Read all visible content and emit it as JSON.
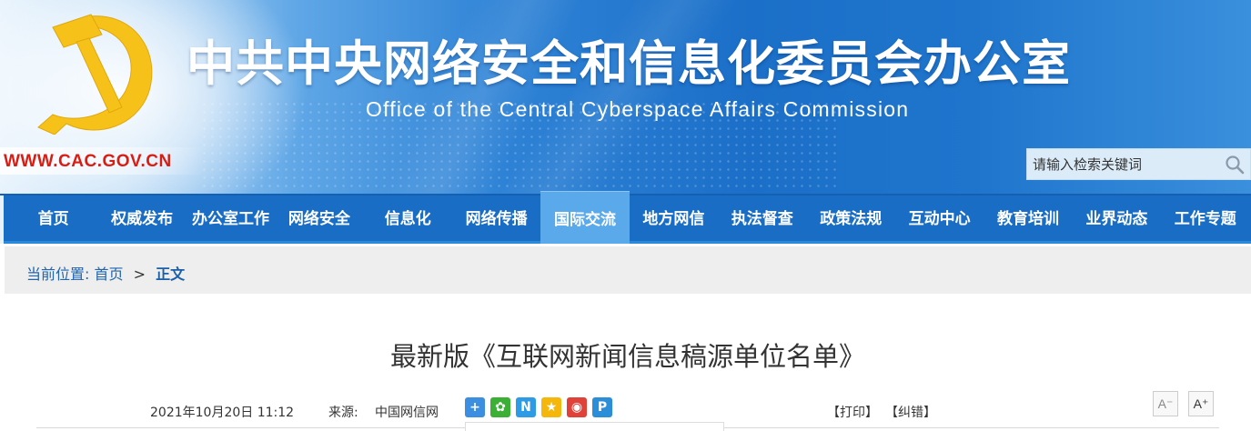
{
  "header": {
    "title": "中共中央网络安全和信息化委员会办公室",
    "subtitle": "Office of the Central Cyberspace Affairs Commission",
    "url": "WWW.CAC.GOV.CN",
    "search_placeholder": "请输入检索关键词"
  },
  "nav": {
    "items": [
      "首页",
      "权威发布",
      "办公室工作",
      "网络安全",
      "信息化",
      "网络传播",
      "国际交流",
      "地方网信",
      "执法督查",
      "政策法规",
      "互动中心",
      "教育培训",
      "业界动态",
      "工作专题"
    ],
    "active_index": 6
  },
  "breadcrumb": {
    "label": "当前位置:",
    "home": "首页",
    "separator": ">",
    "current": "正文"
  },
  "article": {
    "title": "最新版《互联网新闻信息稿源单位名单》",
    "date": "2021年10月20日 11:12",
    "source_label": "来源:",
    "source": "中国网信网",
    "print": "【打印】",
    "correct": "【纠错】",
    "font_small": "A⁻",
    "font_large": "A⁺"
  },
  "share_icons": [
    {
      "name": "share-more-icon",
      "color": "#3b8ee0",
      "glyph": "+"
    },
    {
      "name": "wechat-icon",
      "color": "#3cb034",
      "glyph": "✿"
    },
    {
      "name": "netease-icon",
      "color": "#2d9be5",
      "glyph": "N"
    },
    {
      "name": "qzone-icon",
      "color": "#f5b70b",
      "glyph": "★"
    },
    {
      "name": "weibo-icon",
      "color": "#e0423a",
      "glyph": "◉"
    },
    {
      "name": "renren-icon",
      "color": "#2a8fd8",
      "glyph": "P"
    }
  ],
  "colors": {
    "nav_bg": "#1a6dc4",
    "nav_active": "#5aa9ea",
    "url_red": "#d81e14",
    "crumb_blue": "#2165ad"
  }
}
